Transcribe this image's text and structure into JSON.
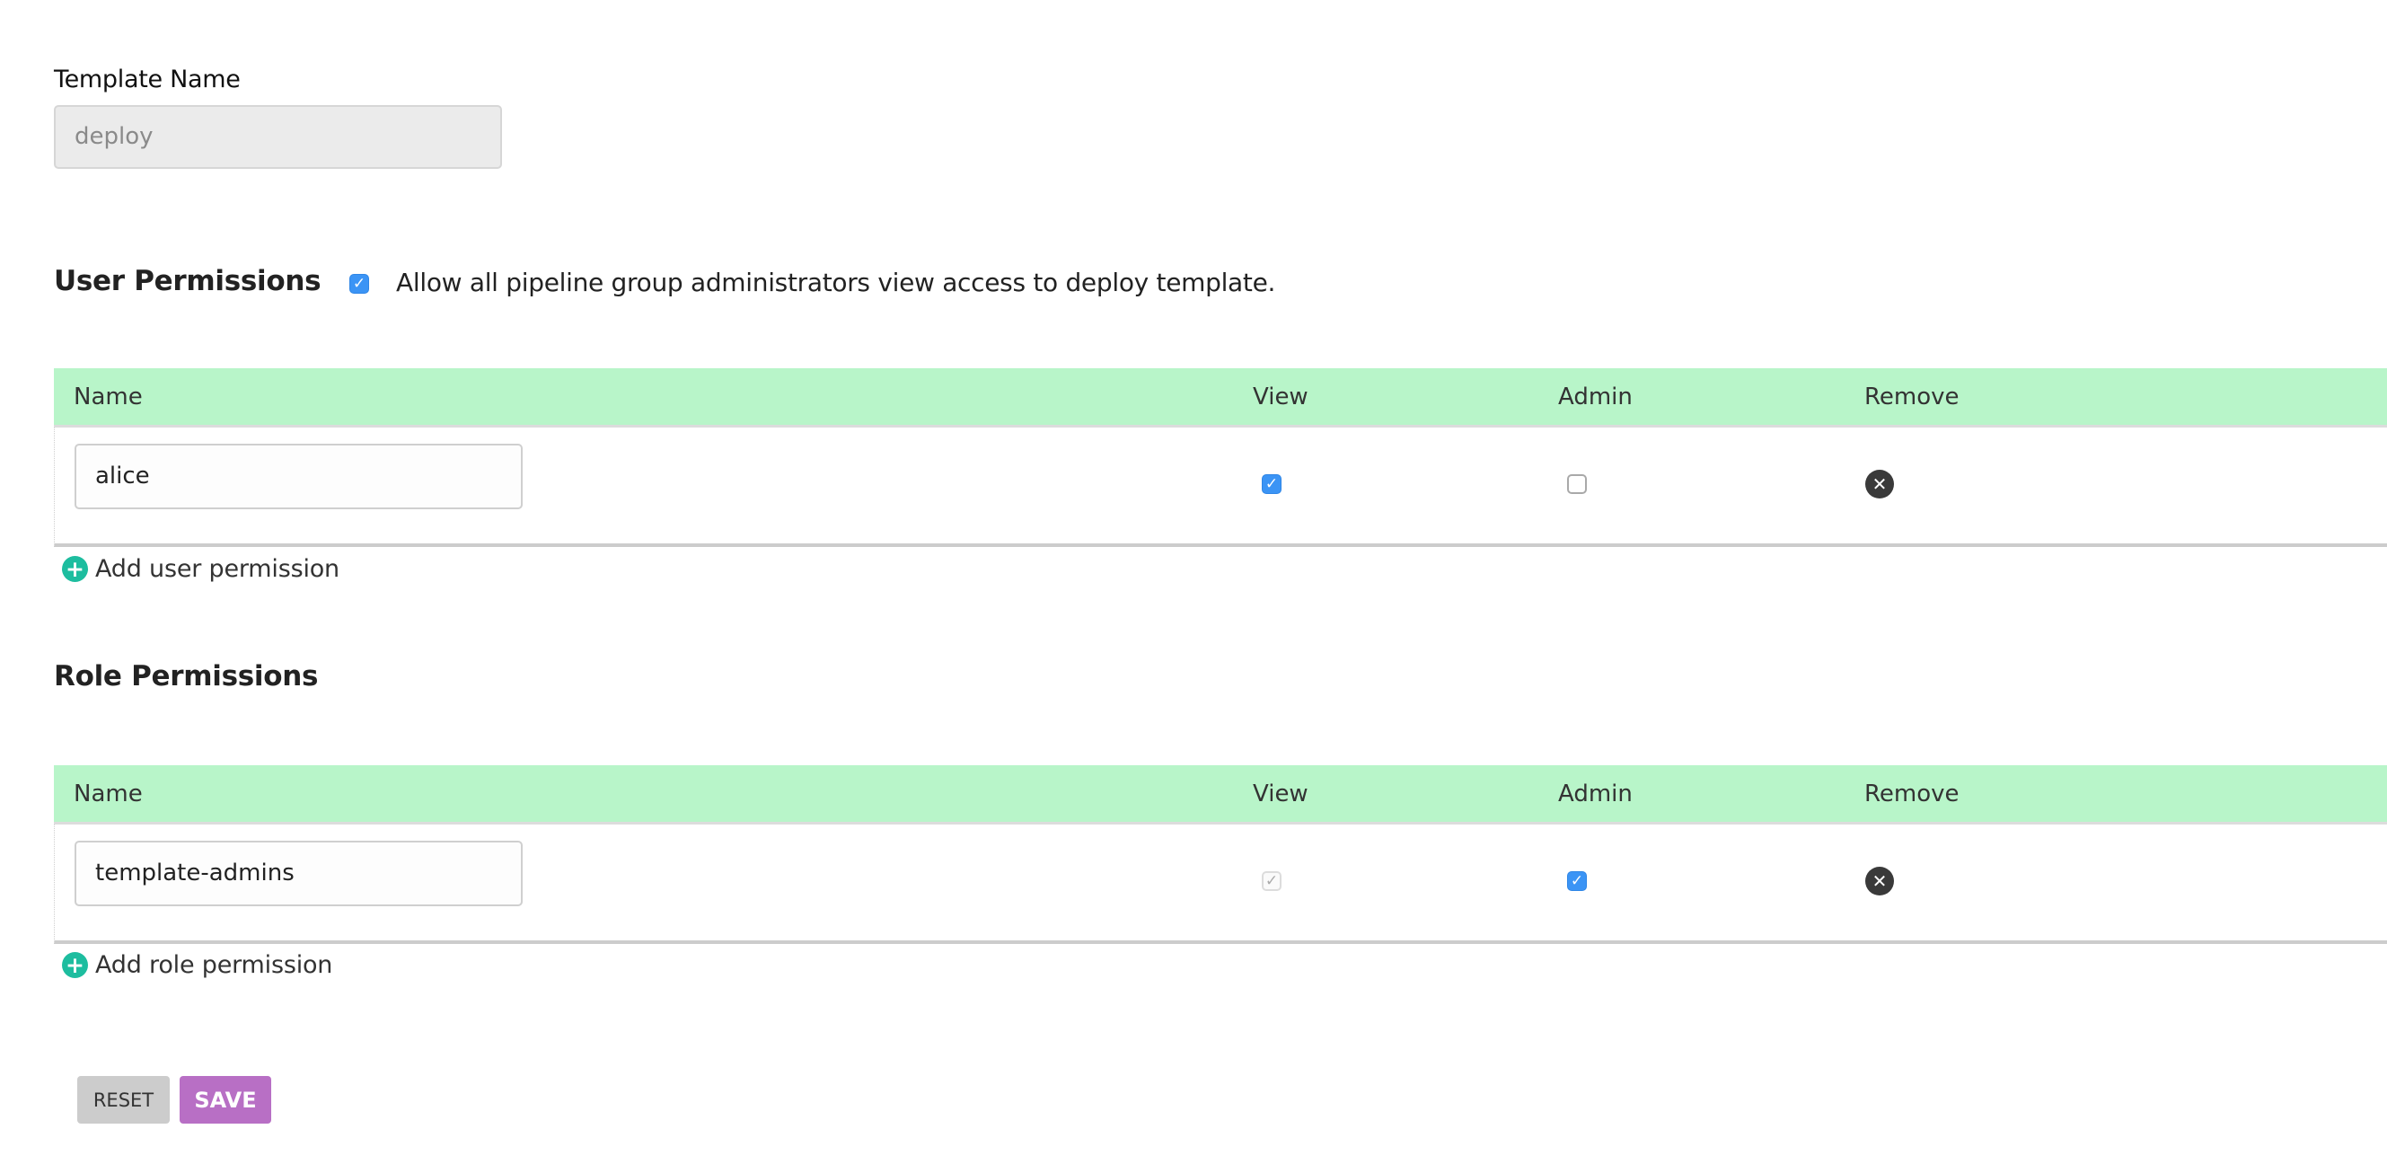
{
  "template": {
    "label": "Template Name",
    "value": "deploy"
  },
  "user_permissions": {
    "heading": "User Permissions",
    "allow_admins_view": {
      "checked": true,
      "label": "Allow all pipeline group administrators view access to deploy template."
    },
    "columns": [
      "Name",
      "View",
      "Admin",
      "Remove"
    ],
    "rows": [
      {
        "name": "alice",
        "view": true,
        "admin": false
      }
    ],
    "add_label": "Add user permission"
  },
  "role_permissions": {
    "heading": "Role Permissions",
    "columns": [
      "Name",
      "View",
      "Admin",
      "Remove"
    ],
    "rows": [
      {
        "name": "template-admins",
        "view": true,
        "view_disabled": true,
        "admin": true
      }
    ],
    "add_label": "Add role permission"
  },
  "icons": {
    "check": "✓",
    "remove": "✕",
    "plus": "+"
  },
  "buttons": {
    "reset": "RESET",
    "save": "SAVE"
  },
  "colors": {
    "header_bg": "#b8f5c9",
    "checkbox_on": "#3b94f5",
    "add_icon": "#1dbd9f",
    "save_button": "#b86fc5",
    "reset_button": "#cccccc"
  }
}
